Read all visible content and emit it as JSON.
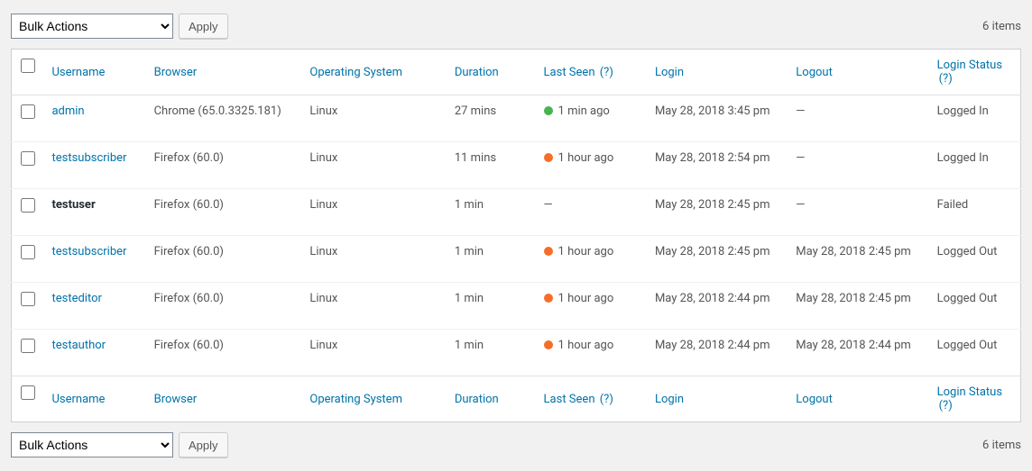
{
  "bulk": {
    "label": "Bulk Actions",
    "apply": "Apply"
  },
  "count_text": "6 items",
  "headers": {
    "username": "Username",
    "browser": "Browser",
    "os": "Operating System",
    "duration": "Duration",
    "last_seen": "Last Seen",
    "login": "Login",
    "logout": "Logout",
    "login_status": "Login Status",
    "help_q": "(?)"
  },
  "rows": [
    {
      "username": "admin",
      "user_link": true,
      "browser": "Chrome (65.0.3325.181)",
      "os": "Linux",
      "duration": "27 mins",
      "last_seen": "1 min ago",
      "last_seen_dot": "green",
      "login": "May 28, 2018 3:45 pm",
      "logout": "—",
      "login_status": "Logged In"
    },
    {
      "username": "testsubscriber",
      "user_link": true,
      "browser": "Firefox (60.0)",
      "os": "Linux",
      "duration": "11 mins",
      "last_seen": "1 hour ago",
      "last_seen_dot": "orange",
      "login": "May 28, 2018 2:54 pm",
      "logout": "—",
      "login_status": "Logged In"
    },
    {
      "username": "testuser",
      "user_link": false,
      "browser": "Firefox (60.0)",
      "os": "Linux",
      "duration": "1 min",
      "last_seen": "—",
      "last_seen_dot": "",
      "login": "May 28, 2018 2:45 pm",
      "logout": "—",
      "login_status": "Failed"
    },
    {
      "username": "testsubscriber",
      "user_link": true,
      "browser": "Firefox (60.0)",
      "os": "Linux",
      "duration": "1 min",
      "last_seen": "1 hour ago",
      "last_seen_dot": "orange",
      "login": "May 28, 2018 2:45 pm",
      "logout": "May 28, 2018 2:45 pm",
      "login_status": "Logged Out"
    },
    {
      "username": "testeditor",
      "user_link": true,
      "browser": "Firefox (60.0)",
      "os": "Linux",
      "duration": "1 min",
      "last_seen": "1 hour ago",
      "last_seen_dot": "orange",
      "login": "May 28, 2018 2:44 pm",
      "logout": "May 28, 2018 2:45 pm",
      "login_status": "Logged Out"
    },
    {
      "username": "testauthor",
      "user_link": true,
      "browser": "Firefox (60.0)",
      "os": "Linux",
      "duration": "1 min",
      "last_seen": "1 hour ago",
      "last_seen_dot": "orange",
      "login": "May 28, 2018 2:44 pm",
      "logout": "May 28, 2018 2:44 pm",
      "login_status": "Logged Out"
    }
  ]
}
